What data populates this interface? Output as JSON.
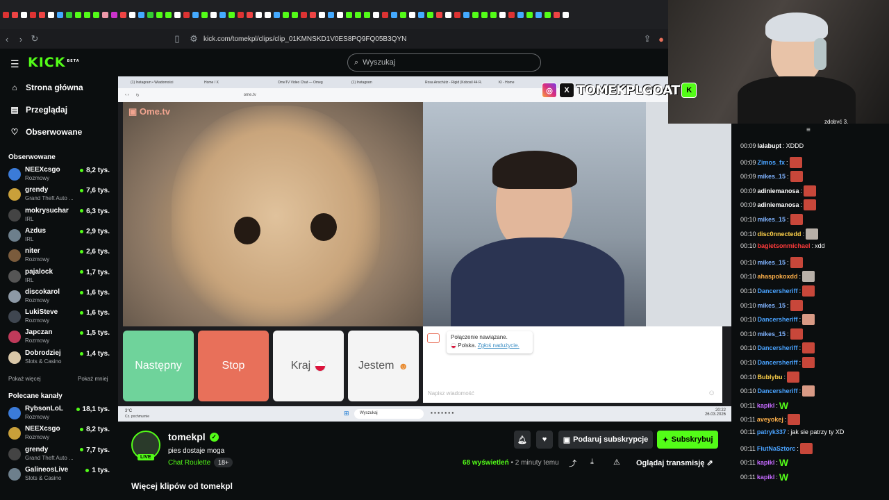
{
  "browser": {
    "url": "kick.com/tomekpl/clips/clip_01KMNSKD1V0ES8PQ9FQ05B3QYN",
    "tab_colors": [
      "#d33",
      "#e44",
      "#fff",
      "#d33",
      "#e44",
      "#fff",
      "#4af",
      "#3c3",
      "#53fc18",
      "#53fc18",
      "#53fc18",
      "#e9a",
      "#c3c",
      "#e44",
      "#fff",
      "#4af",
      "#3c3",
      "#53fc18",
      "#53fc18",
      "#fff",
      "#d33",
      "#4af",
      "#53fc18",
      "#fff",
      "#4af",
      "#53fc18",
      "#d33",
      "#e44",
      "#fff",
      "#fff",
      "#4af",
      "#53fc18",
      "#53fc18",
      "#d33",
      "#e44",
      "#fff",
      "#4af",
      "#fff",
      "#53fc18",
      "#53fc18",
      "#53fc18",
      "#fff",
      "#d33",
      "#4af",
      "#53fc18",
      "#fff",
      "#4af",
      "#53fc18",
      "#e44",
      "#fff",
      "#d33",
      "#4af",
      "#53fc18",
      "#53fc18",
      "#53fc18",
      "#fff",
      "#d33",
      "#4af",
      "#53fc18",
      "#4af",
      "#53fc18",
      "#e44",
      "#fff"
    ]
  },
  "header": {
    "logo": "KICK",
    "logo_badge": "BETA",
    "search_placeholder": "Wyszukaj"
  },
  "sidebar": {
    "nav": [
      {
        "label": "Strona główna",
        "icon": "home-icon"
      },
      {
        "label": "Przeglądaj",
        "icon": "browse-icon"
      },
      {
        "label": "Obserwowane",
        "icon": "heart-icon"
      }
    ],
    "followed_title": "Obserwowane",
    "followed": [
      {
        "name": "NEEXcsgo",
        "category": "Rozmowy",
        "viewers": "8,2 tys."
      },
      {
        "name": "grendy",
        "category": "Grand Theft Auto ...",
        "viewers": "7,6 tys."
      },
      {
        "name": "mokrysuchar",
        "category": "IRL",
        "viewers": "6,3 tys."
      },
      {
        "name": "Azdus",
        "category": "IRL",
        "viewers": "2,9 tys."
      },
      {
        "name": "niter",
        "category": "Rozmowy",
        "viewers": "2,6 tys."
      },
      {
        "name": "pajalock",
        "category": "IRL",
        "viewers": "1,7 tys."
      },
      {
        "name": "discokarol",
        "category": "Rozmowy",
        "viewers": "1,6 tys."
      },
      {
        "name": "LukiSteve",
        "category": "Rozmowy",
        "viewers": "1,6 tys."
      },
      {
        "name": "Japczan",
        "category": "Rozmowy",
        "viewers": "1,5 tys."
      },
      {
        "name": "Dobrodziej",
        "category": "Slots & Casino",
        "viewers": "1,4 tys."
      }
    ],
    "show_more": "Pokaż więcej",
    "show_less": "Pokaż mniej",
    "recommended_title": "Polecane kanały",
    "recommended": [
      {
        "name": "RybsonLoL",
        "category": "Rozmowy",
        "viewers": "18,1 tys."
      },
      {
        "name": "NEEXcsgo",
        "category": "Rozmowy",
        "viewers": "8,2 tys."
      },
      {
        "name": "grendy",
        "category": "Grand Theft Auto ...",
        "viewers": "7,7 tys."
      },
      {
        "name": "GalineosLive",
        "category": "Slots & Casino",
        "viewers": "1 tys."
      }
    ]
  },
  "video": {
    "inner_tabs": [
      "(1) Instagram • Wiadomości",
      "Home / X",
      "OmeTV Video Chat — Omeg",
      "(1) Instagram",
      "Rosa Anschütz - Rigid (Kobosil 44 R.",
      "KI - Home"
    ],
    "inner_url": "ome.tv",
    "ome_logo": "Ome.tv",
    "buttons": {
      "next": "Następny",
      "stop": "Stop",
      "country": "Kraj",
      "gender": "Jestem"
    },
    "chat_status": "Połączenie nawiązane.",
    "chat_country": "Polska.",
    "chat_report": "Zgłoś nadużycie.",
    "chat_placeholder": "Napisz wiadomość",
    "taskbar_search": "Wyszukaj",
    "weather": "3°C",
    "weather_desc": "Cz. pochmurnie",
    "clock_time": "20:22",
    "clock_date": "26.03.2026"
  },
  "overlay": {
    "handle": "TOMEKPLGOAT",
    "sub_text": "zdobyć 3."
  },
  "channel": {
    "name": "tomekpl",
    "live_badge": "LIVE",
    "clip_title": "pies dostaje moga",
    "category": "Chat Roulette",
    "age_badge": "18+",
    "views_count": "68",
    "views_label": "wyświetleń",
    "time_ago": "• 2 minuty temu",
    "gift_button": "Podaruj subskrypcje",
    "subscribe_button": "Subskrybuj",
    "watch_button": "Oglądaj transmisję",
    "more_clips": "Więcej klipów od tomekpl"
  },
  "chat": {
    "messages": [
      {
        "time": "00:09",
        "user": "lalabupt",
        "color": "#ffffff",
        "text": "XDDD",
        "emote": ""
      },
      {
        "time": "00:09",
        "user": "Zimos_fx",
        "color": "#4aa3ff",
        "text": "",
        "emote": "red"
      },
      {
        "time": "00:09",
        "user": "mikes_15",
        "color": "#7fb3ff",
        "text": "",
        "emote": "red"
      },
      {
        "time": "00:09",
        "user": "adiniemanosa",
        "color": "#ffffff",
        "text": "",
        "emote": "red"
      },
      {
        "time": "00:09",
        "user": "adiniemanosa",
        "color": "#ffffff",
        "text": "",
        "emote": "red"
      },
      {
        "time": "00:10",
        "user": "mikes_15",
        "color": "#7fb3ff",
        "text": "",
        "emote": "red"
      },
      {
        "time": "00:10",
        "user": "disc0nnectedd",
        "color": "#ffd24a",
        "text": "",
        "emote": "face"
      },
      {
        "time": "00:10",
        "user": "bagietsonmichael",
        "color": "#ff3b3b",
        "text": "xdd",
        "emote": ""
      },
      {
        "time": "00:10",
        "user": "mikes_15",
        "color": "#7fb3ff",
        "text": "",
        "emote": "red"
      },
      {
        "time": "00:10",
        "user": "ahaspokoxdd",
        "color": "#ffb14a",
        "text": "",
        "emote": "face"
      },
      {
        "time": "00:10",
        "user": "Dancersheriff",
        "color": "#4aa3ff",
        "text": "",
        "emote": "red"
      },
      {
        "time": "00:10",
        "user": "mikes_15",
        "color": "#7fb3ff",
        "text": "",
        "emote": "red"
      },
      {
        "time": "00:10",
        "user": "Dancersheriff",
        "color": "#4aa3ff",
        "text": "",
        "emote": "hand"
      },
      {
        "time": "00:10",
        "user": "mikes_15",
        "color": "#7fb3ff",
        "text": "",
        "emote": "red"
      },
      {
        "time": "00:10",
        "user": "Dancersheriff",
        "color": "#4aa3ff",
        "text": "",
        "emote": "red"
      },
      {
        "time": "00:10",
        "user": "Dancersheriff",
        "color": "#4aa3ff",
        "text": "",
        "emote": "red"
      },
      {
        "time": "00:10",
        "user": "Bublybu",
        "color": "#ffd24a",
        "text": "",
        "emote": "red"
      },
      {
        "time": "00:10",
        "user": "Dancersheriff",
        "color": "#4aa3ff",
        "text": "",
        "emote": "hand"
      },
      {
        "time": "00:11",
        "user": "kapikl",
        "color": "#c56bff",
        "text": "",
        "emote": "w"
      },
      {
        "time": "00:11",
        "user": "aveyokej",
        "color": "#ffb14a",
        "text": "",
        "emote": "red"
      },
      {
        "time": "00:11",
        "user": "patryk337",
        "color": "#4aa3ff",
        "text": "jak sie patrzy ty XD",
        "emote": ""
      },
      {
        "time": "00:11",
        "user": "FiutNaSztorc",
        "color": "#4aa3ff",
        "text": "",
        "emote": "red"
      },
      {
        "time": "00:11",
        "user": "kapikl",
        "color": "#c56bff",
        "text": "",
        "emote": "w"
      },
      {
        "time": "00:11",
        "user": "kapikl",
        "color": "#c56bff",
        "text": "",
        "emote": "w"
      }
    ]
  },
  "colors": {
    "accent": "#53fc18",
    "stop": "#e8705a",
    "next": "#6fd39b"
  }
}
